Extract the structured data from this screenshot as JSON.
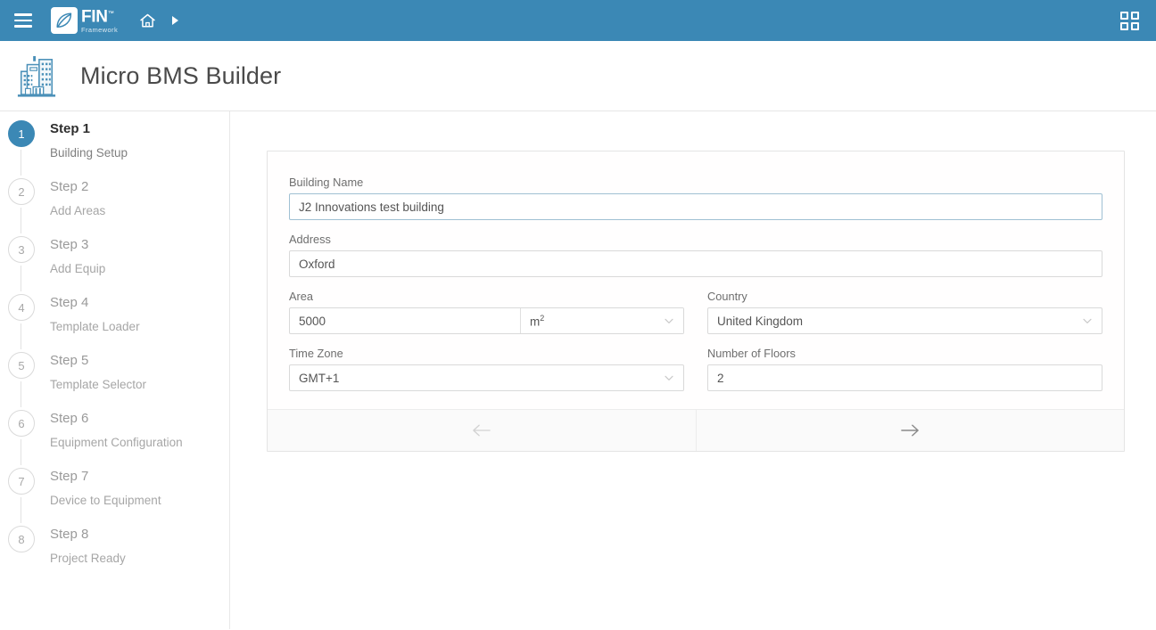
{
  "topbar": {
    "menu_icon": "hamburger-icon",
    "logo_primary": "FIN",
    "logo_trademark": "™",
    "logo_secondary": "Framework",
    "home_icon": "home-icon",
    "caret_icon": "caret-right-icon",
    "apps_icon": "apps-grid-icon",
    "background_color": "#3b88b5"
  },
  "page": {
    "title": "Micro BMS Builder",
    "icon": "building-icon"
  },
  "sidebar": {
    "steps": [
      {
        "number": "1",
        "title": "Step 1",
        "subtitle": "Building Setup",
        "active": true
      },
      {
        "number": "2",
        "title": "Step 2",
        "subtitle": "Add Areas",
        "active": false
      },
      {
        "number": "3",
        "title": "Step 3",
        "subtitle": "Add Equip",
        "active": false
      },
      {
        "number": "4",
        "title": "Step 4",
        "subtitle": "Template Loader",
        "active": false
      },
      {
        "number": "5",
        "title": "Step 5",
        "subtitle": "Template Selector",
        "active": false
      },
      {
        "number": "6",
        "title": "Step 6",
        "subtitle": "Equipment Configuration",
        "active": false
      },
      {
        "number": "7",
        "title": "Step 7",
        "subtitle": "Device to Equipment",
        "active": false
      },
      {
        "number": "8",
        "title": "Step 8",
        "subtitle": "Project Ready",
        "active": false
      }
    ],
    "active_color": "#3b88b5"
  },
  "form": {
    "building_name": {
      "label": "Building Name",
      "value": "J2 Innovations test building",
      "placeholder": "Building Name"
    },
    "address": {
      "label": "Address",
      "value": "Oxford",
      "placeholder": "Address"
    },
    "area": {
      "label": "Area",
      "value": "5000",
      "placeholder": "Area",
      "unit_value": "m",
      "unit_superscript": "2",
      "unit_icon": "chevron-down-icon"
    },
    "country": {
      "label": "Country",
      "value": "United Kingdom",
      "icon": "chevron-down-icon"
    },
    "time_zone": {
      "label": "Time Zone",
      "value": "GMT+1",
      "icon": "chevron-down-icon"
    },
    "number_of_floors": {
      "label": "Number of Floors",
      "value": "2",
      "placeholder": "Number of Floors"
    }
  },
  "footer": {
    "prev_icon": "arrow-left-icon",
    "next_icon": "arrow-right-icon",
    "prev_enabled": false,
    "next_enabled": true
  }
}
